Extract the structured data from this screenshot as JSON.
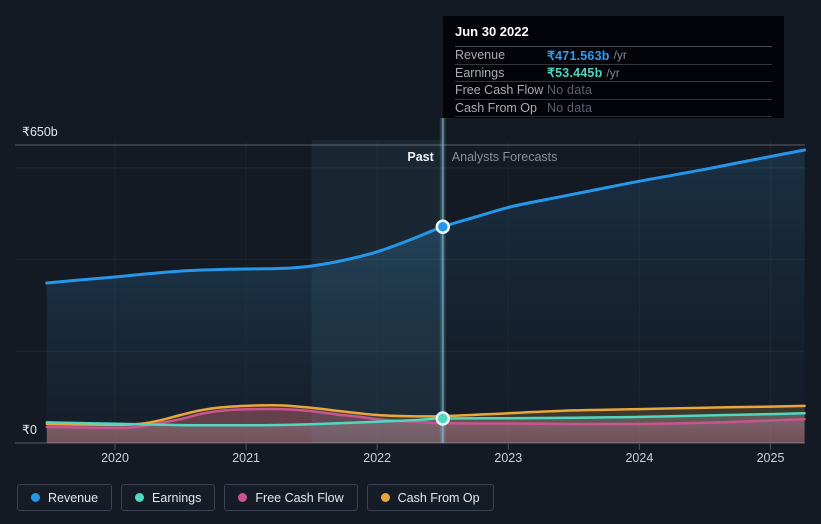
{
  "page": {
    "background": "#141a24"
  },
  "tooltip": {
    "date": "Jun 30 2022",
    "rows": [
      {
        "label": "Revenue",
        "value": "₹471.563b",
        "unit": "/yr",
        "value_color": "#2f9df2"
      },
      {
        "label": "Earnings",
        "value": "₹53.445b",
        "unit": "/yr",
        "value_color": "#4ed6c0"
      },
      {
        "label": "Free Cash Flow",
        "value": "No data",
        "unit": "",
        "value_color": "#5b626c"
      },
      {
        "label": "Cash From Op",
        "value": "No data",
        "unit": "",
        "value_color": "#5b626c"
      }
    ]
  },
  "legend": {
    "items": [
      {
        "label": "Revenue",
        "color": "#2697e8"
      },
      {
        "label": "Earnings",
        "color": "#52d7bf"
      },
      {
        "label": "Free Cash Flow",
        "color": "#c9548f"
      },
      {
        "label": "Cash From Op",
        "color": "#e8a63d"
      }
    ]
  },
  "chart_data": {
    "type": "line",
    "currency_unit": "₹b",
    "x_axis": {
      "tick_years": [
        2020,
        2021,
        2022,
        2023,
        2024,
        2025
      ],
      "range": [
        2019.45,
        2025.3
      ]
    },
    "y_axis": {
      "min": 0,
      "max": 650,
      "top_label": "₹650b",
      "zero_label": "₹0",
      "gridlines": [
        {
          "value": 650,
          "major": true,
          "label": "₹650b"
        },
        {
          "value": 600
        },
        {
          "value": 400
        },
        {
          "value": 200
        },
        {
          "value": 0,
          "major": true,
          "label": "₹0"
        }
      ]
    },
    "divider": {
      "year": 2022.5,
      "past_label": "Past",
      "forecast_label": "Analysts Forecasts"
    },
    "highlight_band": {
      "from_year": 2021.5,
      "to_year": 2022.5
    },
    "series": [
      {
        "name": "Revenue",
        "color": "#2697e8",
        "width": 3,
        "points": [
          [
            2019.48,
            349
          ],
          [
            2019.75,
            356
          ],
          [
            2020,
            362
          ],
          [
            2020.25,
            369
          ],
          [
            2020.5,
            375
          ],
          [
            2020.75,
            378
          ],
          [
            2021,
            379.5
          ],
          [
            2021.15,
            380
          ],
          [
            2021.3,
            381
          ],
          [
            2021.5,
            386
          ],
          [
            2021.75,
            399
          ],
          [
            2022,
            417
          ],
          [
            2022.25,
            443
          ],
          [
            2022.5,
            471.563
          ],
          [
            2022.75,
            493
          ],
          [
            2023,
            514
          ],
          [
            2023.25,
            529
          ],
          [
            2023.5,
            543
          ],
          [
            2023.75,
            557
          ],
          [
            2024,
            571
          ],
          [
            2024.25,
            584
          ],
          [
            2024.5,
            597
          ],
          [
            2024.75,
            611
          ],
          [
            2025,
            625
          ],
          [
            2025.26,
            639
          ]
        ]
      },
      {
        "name": "Cash From Op",
        "color": "#e8a63d",
        "width": 2.5,
        "points": [
          [
            2019.48,
            41.5
          ],
          [
            2020,
            39.5
          ],
          [
            2020.2,
            42
          ],
          [
            2020.35,
            50
          ],
          [
            2020.5,
            61
          ],
          [
            2020.65,
            71
          ],
          [
            2020.8,
            77.5
          ],
          [
            2020.95,
            80.5
          ],
          [
            2021.1,
            82
          ],
          [
            2021.26,
            82
          ],
          [
            2021.4,
            79.5
          ],
          [
            2021.56,
            75
          ],
          [
            2021.7,
            70
          ],
          [
            2021.87,
            64.5
          ],
          [
            2022,
            61
          ],
          [
            2022.17,
            59
          ],
          [
            2022.5,
            58.5
          ],
          [
            2023,
            65
          ],
          [
            2023.5,
            71
          ],
          [
            2024,
            74
          ],
          [
            2024.5,
            77
          ],
          [
            2025,
            79.5
          ],
          [
            2025.26,
            81
          ]
        ]
      },
      {
        "name": "Free Cash Flow",
        "color": "#c9548f",
        "width": 2.5,
        "points": [
          [
            2019.48,
            35
          ],
          [
            2020,
            33
          ],
          [
            2020.2,
            36
          ],
          [
            2020.35,
            44
          ],
          [
            2020.5,
            52
          ],
          [
            2020.65,
            63
          ],
          [
            2020.8,
            70
          ],
          [
            2020.95,
            73
          ],
          [
            2021.1,
            74
          ],
          [
            2021.26,
            74
          ],
          [
            2021.4,
            72
          ],
          [
            2021.56,
            67.5
          ],
          [
            2021.7,
            62
          ],
          [
            2021.87,
            57
          ],
          [
            2022,
            52
          ],
          [
            2022.17,
            48
          ],
          [
            2022.35,
            45.5
          ],
          [
            2022.5,
            43
          ],
          [
            2023,
            42.5
          ],
          [
            2023.5,
            41.5
          ],
          [
            2024,
            41.5
          ],
          [
            2024.5,
            44
          ],
          [
            2025,
            49
          ],
          [
            2025.26,
            52
          ]
        ]
      },
      {
        "name": "Earnings",
        "color": "#52d7bf",
        "width": 2.5,
        "points": [
          [
            2019.48,
            45
          ],
          [
            2020,
            42
          ],
          [
            2020.5,
            39
          ],
          [
            2021,
            38.5
          ],
          [
            2021.3,
            39.5
          ],
          [
            2021.6,
            42
          ],
          [
            2022,
            46.5
          ],
          [
            2022.3,
            50
          ],
          [
            2022.5,
            53.445
          ],
          [
            2023,
            54
          ],
          [
            2023.5,
            55
          ],
          [
            2024,
            57
          ],
          [
            2024.5,
            60
          ],
          [
            2025,
            63
          ],
          [
            2025.26,
            65
          ]
        ]
      }
    ],
    "markers": [
      {
        "series": "Revenue",
        "year": 2022.5,
        "value": 471.563
      },
      {
        "series": "Earnings",
        "year": 2022.5,
        "value": 53.445
      }
    ]
  }
}
